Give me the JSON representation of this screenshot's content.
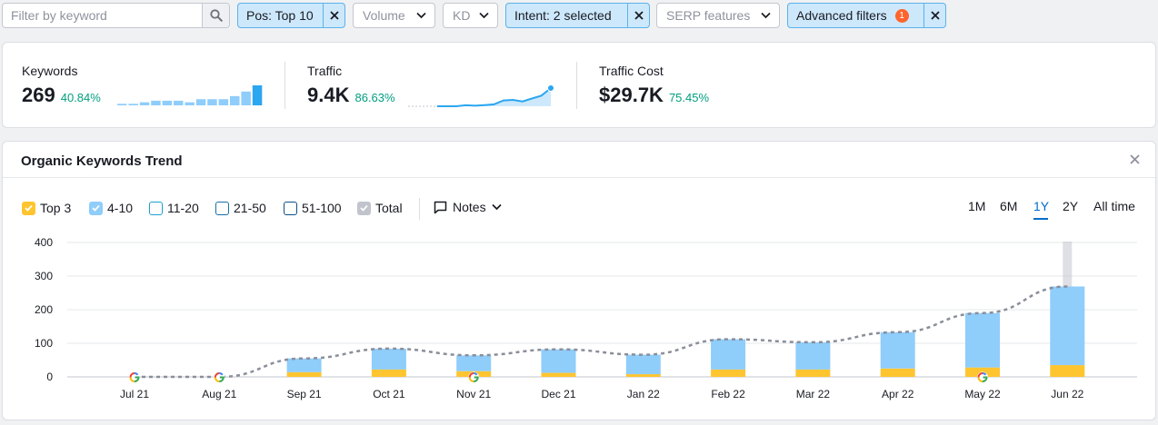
{
  "filters": {
    "search_placeholder": "Filter by keyword",
    "chips": [
      {
        "label": "Pos: Top 10",
        "active": true
      },
      {
        "label": "Volume",
        "active": false
      },
      {
        "label": "KD",
        "active": false
      },
      {
        "label": "Intent: 2 selected",
        "active": true
      },
      {
        "label": "SERP features",
        "active": false
      },
      {
        "label": "Advanced filters",
        "active": true,
        "badge": "1"
      }
    ]
  },
  "summary": {
    "keywords": {
      "label": "Keywords",
      "value": "269",
      "change": "40.84%"
    },
    "traffic": {
      "label": "Traffic",
      "value": "9.4K",
      "change": "86.63%"
    },
    "traffic_cost": {
      "label": "Traffic Cost",
      "value": "$29.7K",
      "change": "75.45%"
    }
  },
  "trend": {
    "title": "Organic Keywords Trend",
    "legend": [
      {
        "label": "Top 3",
        "checked": true,
        "color": "#ffc530"
      },
      {
        "label": "4-10",
        "checked": true,
        "color": "#8fcdfb"
      },
      {
        "label": "11-20",
        "checked": false,
        "color": "#1ba0cf"
      },
      {
        "label": "21-50",
        "checked": false,
        "color": "#1670a6"
      },
      {
        "label": "51-100",
        "checked": false,
        "color": "#0c4f86"
      },
      {
        "label": "Total",
        "checked": true,
        "color": "#c1c4cc"
      }
    ],
    "notes_label": "Notes",
    "ranges": [
      "1M",
      "6M",
      "1Y",
      "2Y",
      "All time"
    ],
    "selected_range": "1Y"
  },
  "colors": {
    "accent": "#006dca",
    "positive": "#009f81",
    "chip_active_bg": "#cde8fb",
    "top3": "#ffc530",
    "pos4_10": "#8fcdfb",
    "total_line": "#8a8e99"
  },
  "chart_data": {
    "type": "bar",
    "stacked": true,
    "categories": [
      "Jul 21",
      "Aug 21",
      "Sep 21",
      "Oct 21",
      "Nov 21",
      "Dec 21",
      "Jan 22",
      "Feb 22",
      "Mar 22",
      "Apr 22",
      "May 22",
      "Jun 22"
    ],
    "series": [
      {
        "name": "Top 3",
        "values": [
          0,
          0,
          14,
          22,
          17,
          12,
          8,
          22,
          22,
          25,
          28,
          35
        ]
      },
      {
        "name": "4-10",
        "values": [
          0,
          0,
          41,
          62,
          47,
          70,
          58,
          90,
          81,
          108,
          162,
          234
        ]
      },
      {
        "name": "Total",
        "type": "line",
        "values": [
          0,
          0,
          55,
          84,
          64,
          82,
          66,
          112,
          103,
          133,
          190,
          269
        ]
      }
    ],
    "google_update_markers": [
      "Jul 21",
      "Aug 21",
      "Nov 21",
      "May 22"
    ],
    "yticks": [
      0,
      100,
      200,
      300,
      400
    ],
    "ylim": [
      0,
      400
    ],
    "grid": true,
    "highlighted_category": "Jun 22"
  },
  "sparklines": {
    "keywords": [
      1,
      1,
      2,
      3,
      3,
      3,
      2,
      4,
      4,
      4,
      6,
      9,
      13
    ],
    "traffic": [
      0,
      0,
      0,
      0.5,
      0.3,
      0.6,
      1,
      3,
      3.3,
      2.5,
      4,
      5.5,
      9.4
    ]
  }
}
